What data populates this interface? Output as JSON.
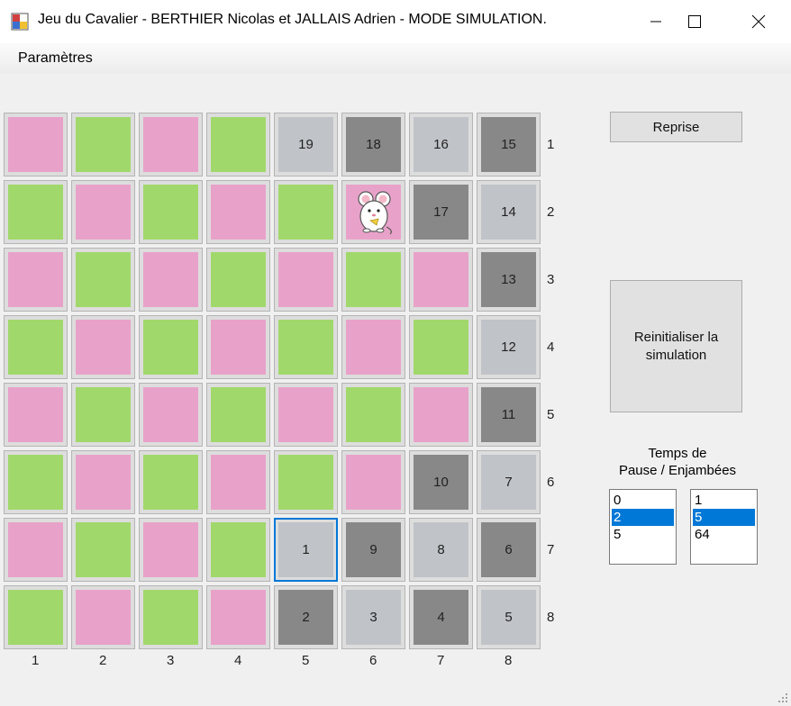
{
  "window": {
    "title": "Jeu du Cavalier - BERTHIER Nicolas et JALLAIS Adrien - MODE SIMULATION.",
    "app_icon": "board-game-icon",
    "controls": [
      "minimize-icon",
      "maximize-icon",
      "close-icon"
    ]
  },
  "menu": {
    "items": [
      {
        "label": "Paramètres"
      }
    ]
  },
  "colors": {
    "pink": "#e8a2c9",
    "green": "#a1d86b",
    "visited_light": "#c0c3c8",
    "visited_dark": "#888888",
    "selection": "#0078d7"
  },
  "board": {
    "rows": [
      [
        {
          "c": "pink"
        },
        {
          "c": "green"
        },
        {
          "c": "pink"
        },
        {
          "c": "green"
        },
        {
          "c": "light",
          "v": "19"
        },
        {
          "c": "dark",
          "v": "18"
        },
        {
          "c": "light",
          "v": "16"
        },
        {
          "c": "dark",
          "v": "15"
        }
      ],
      [
        {
          "c": "green"
        },
        {
          "c": "pink"
        },
        {
          "c": "green"
        },
        {
          "c": "pink"
        },
        {
          "c": "green"
        },
        {
          "c": "pink",
          "icon": "mouse"
        },
        {
          "c": "dark",
          "v": "17"
        },
        {
          "c": "light",
          "v": "14"
        }
      ],
      [
        {
          "c": "pink"
        },
        {
          "c": "green"
        },
        {
          "c": "pink"
        },
        {
          "c": "green"
        },
        {
          "c": "pink"
        },
        {
          "c": "green"
        },
        {
          "c": "pink"
        },
        {
          "c": "dark",
          "v": "13"
        }
      ],
      [
        {
          "c": "green"
        },
        {
          "c": "pink"
        },
        {
          "c": "green"
        },
        {
          "c": "pink"
        },
        {
          "c": "green"
        },
        {
          "c": "pink"
        },
        {
          "c": "green"
        },
        {
          "c": "light",
          "v": "12"
        }
      ],
      [
        {
          "c": "pink"
        },
        {
          "c": "green"
        },
        {
          "c": "pink"
        },
        {
          "c": "green"
        },
        {
          "c": "pink"
        },
        {
          "c": "green"
        },
        {
          "c": "pink"
        },
        {
          "c": "dark",
          "v": "11"
        }
      ],
      [
        {
          "c": "green"
        },
        {
          "c": "pink"
        },
        {
          "c": "green"
        },
        {
          "c": "pink"
        },
        {
          "c": "green"
        },
        {
          "c": "pink"
        },
        {
          "c": "dark",
          "v": "10"
        },
        {
          "c": "light",
          "v": "7"
        }
      ],
      [
        {
          "c": "pink"
        },
        {
          "c": "green"
        },
        {
          "c": "pink"
        },
        {
          "c": "green"
        },
        {
          "c": "light",
          "v": "1",
          "selected": true
        },
        {
          "c": "dark",
          "v": "9"
        },
        {
          "c": "light",
          "v": "8"
        },
        {
          "c": "dark",
          "v": "6"
        }
      ],
      [
        {
          "c": "green"
        },
        {
          "c": "pink"
        },
        {
          "c": "green"
        },
        {
          "c": "pink"
        },
        {
          "c": "dark",
          "v": "2"
        },
        {
          "c": "light",
          "v": "3"
        },
        {
          "c": "dark",
          "v": "4"
        },
        {
          "c": "light",
          "v": "5"
        }
      ]
    ],
    "row_labels": [
      "1",
      "2",
      "3",
      "4",
      "5",
      "6",
      "7",
      "8"
    ],
    "col_labels": [
      "1",
      "2",
      "3",
      "4",
      "5",
      "6",
      "7",
      "8"
    ]
  },
  "buttons": {
    "reprise": "Reprise",
    "reset_line1": "Reinitialiser la",
    "reset_line2": "simulation"
  },
  "temps": {
    "label_line1": "Temps de",
    "label_line2": "Pause / Enjambées",
    "pause_options": [
      "0",
      "2",
      "5"
    ],
    "pause_selected": 1,
    "enjambees_options": [
      "1",
      "5",
      "64"
    ],
    "enjambees_selected": 1
  }
}
